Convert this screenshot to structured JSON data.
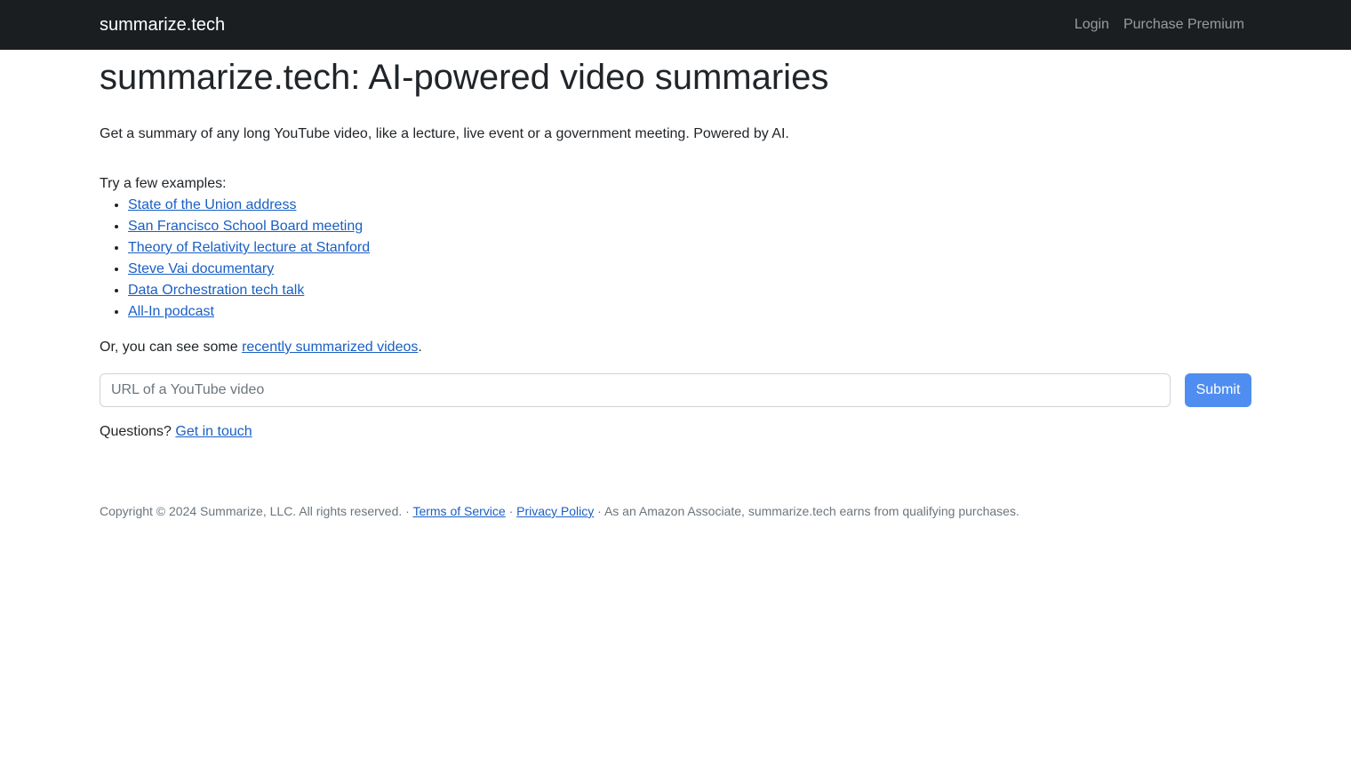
{
  "navbar": {
    "brand": "summarize.tech",
    "links": [
      "Login",
      "Purchase Premium"
    ]
  },
  "main": {
    "title": "summarize.tech: AI-powered video summaries",
    "lead": "Get a summary of any long YouTube video, like a lecture, live event or a government meeting. Powered by AI.",
    "examples_label": "Try a few examples:",
    "examples": [
      "State of the Union address",
      "San Francisco School Board meeting",
      "Theory of Relativity lecture at Stanford",
      "Steve Vai documentary",
      "Data Orchestration tech talk",
      "All-In podcast"
    ],
    "recent_prefix": "Or, you can see some ",
    "recent_link": "recently summarized videos",
    "recent_suffix": ".",
    "url_input": {
      "placeholder": "URL of a YouTube video",
      "value": ""
    },
    "submit_label": "Submit",
    "questions_prefix": "Questions? ",
    "questions_link": "Get in touch"
  },
  "footer": {
    "copyright": "Copyright © 2024 Summarize, LLC. All rights reserved. · ",
    "terms": "Terms of Service",
    "sep": " · ",
    "privacy": "Privacy Policy",
    "amazon": " · As an Amazon Associate, summarize.tech earns from qualifying purchases."
  }
}
